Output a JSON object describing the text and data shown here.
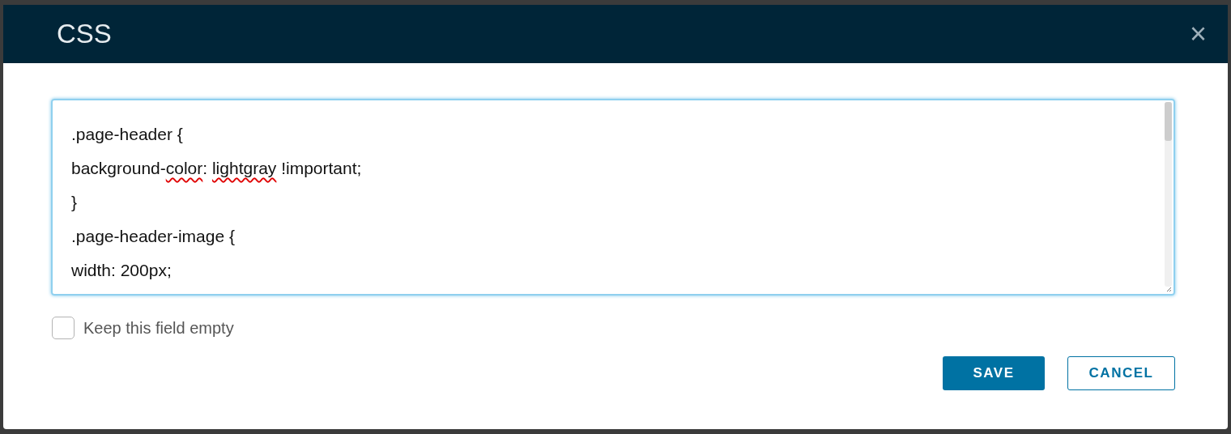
{
  "dialog": {
    "title": "CSS",
    "close": "×"
  },
  "editor": {
    "lines": [
      [
        {
          "text": ".page-header {",
          "misspelled": false
        }
      ],
      [
        {
          "text": "background-",
          "misspelled": false
        },
        {
          "text": "color",
          "misspelled": true
        },
        {
          "text": ": ",
          "misspelled": false
        },
        {
          "text": "lightgray",
          "misspelled": true
        },
        {
          "text": " !important;",
          "misspelled": false
        }
      ],
      [
        {
          "text": "}",
          "misspelled": false
        }
      ],
      [
        {
          "text": ".page-header-image {",
          "misspelled": false
        }
      ],
      [
        {
          "text": "width: 200px;",
          "misspelled": false
        }
      ]
    ]
  },
  "checkbox": {
    "label": "Keep this field empty",
    "checked": false
  },
  "buttons": [
    {
      "label": "SAVE",
      "kind": "primary"
    },
    {
      "label": "CANCEL",
      "kind": "outline"
    }
  ]
}
